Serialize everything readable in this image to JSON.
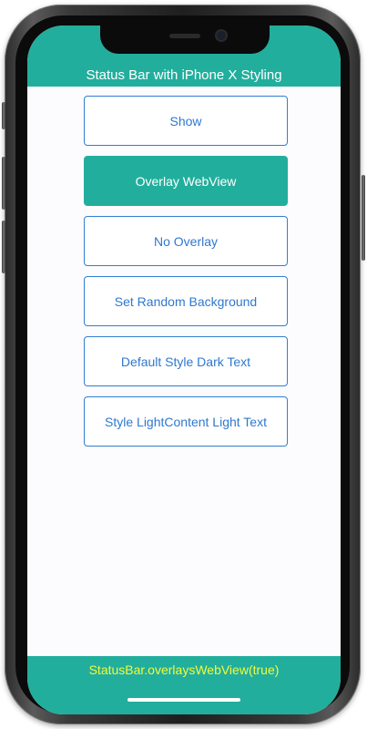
{
  "header": {
    "title": "Status Bar with iPhone X Styling"
  },
  "buttons": [
    {
      "label": "Show"
    },
    {
      "label": "Overlay WebView"
    },
    {
      "label": "No Overlay"
    },
    {
      "label": "Set Random Background"
    },
    {
      "label": "Default Style Dark Text"
    },
    {
      "label": "Style LightContent Light Text"
    }
  ],
  "footer": {
    "status_text": "StatusBar.overlaysWebView(true)"
  },
  "colors": {
    "accent": "#22ae9d",
    "button_border": "#2f80d1",
    "button_text": "#2f78cf",
    "footer_text": "#f1fa3c"
  },
  "state": {
    "active_button": "Overlay WebView"
  }
}
